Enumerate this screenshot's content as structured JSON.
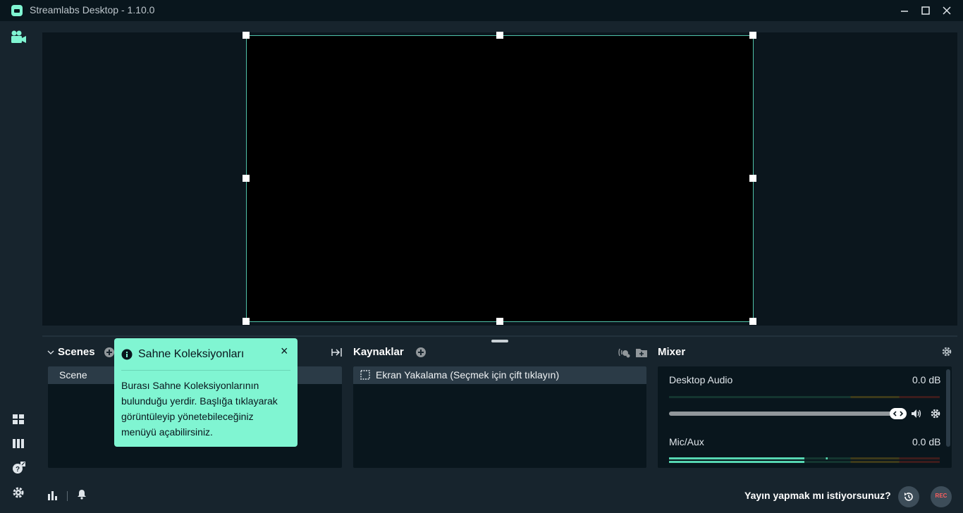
{
  "window": {
    "title": "Streamlabs Desktop - 1.10.0"
  },
  "nav": {
    "items": [
      "studio-mode",
      "layout-editor",
      "theme-audit",
      "help",
      "settings"
    ]
  },
  "scenes": {
    "title": "Scenes",
    "items": [
      "Scene"
    ]
  },
  "tooltip": {
    "title": "Sahne Koleksiyonları",
    "body": "Burası Sahne Koleksiyonlarının bulunduğu yerdir. Başlığa tıklayarak görüntüleyip yönetebileceğiniz menüyü açabilirsiniz.",
    "close_label": "×"
  },
  "sources": {
    "title": "Kaynaklar",
    "items": [
      "Ekran Yakalama (Seçmek için çift tıklayın)"
    ]
  },
  "mixer": {
    "title": "Mixer",
    "channels": [
      {
        "name": "Desktop Audio",
        "level": "0.0 dB",
        "volume": 1.0
      },
      {
        "name": "Mic/Aux",
        "level": "0.0 dB",
        "meter": 0.5
      }
    ]
  },
  "footer": {
    "cta": "Yayın yapmak mı istiyorsunuz?",
    "rec_label": "REC"
  },
  "colors": {
    "accent": "#80f5d2",
    "background": "#17242d",
    "panel": "#09161d",
    "rec": "#ff5f5f"
  },
  "icons": [
    "app-logo-icon",
    "minimize-icon",
    "maximize-icon",
    "close-icon",
    "video-camera-icon",
    "layout-icon",
    "columns-icon",
    "help-icon",
    "settings-icon",
    "chevron-down-icon",
    "add-scene-icon",
    "info-icon",
    "collapse-icon",
    "add-source-icon",
    "add-folder-icon",
    "audio-filter-icon",
    "mixer-settings-icon",
    "speaker-icon",
    "channel-settings-icon",
    "stats-icon",
    "bell-icon",
    "replay-icon"
  ]
}
